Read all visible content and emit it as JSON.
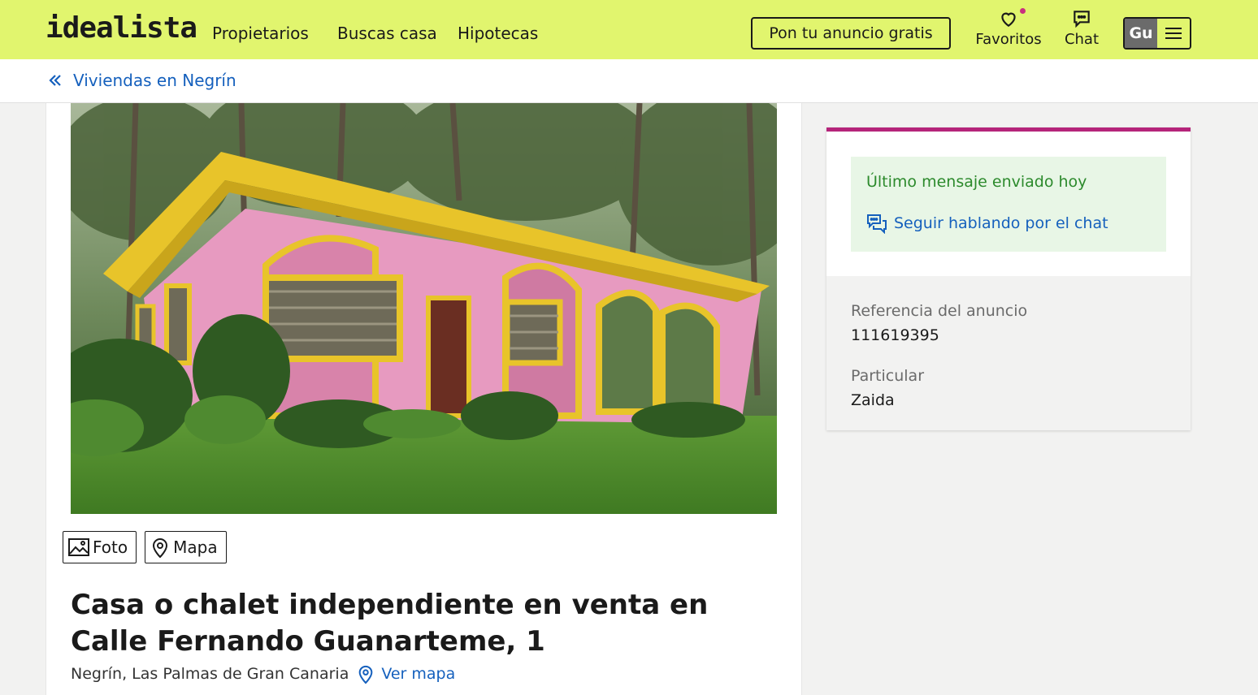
{
  "header": {
    "logo": "idealista",
    "nav": [
      "Propietarios",
      "Buscas casa",
      "Hipotecas"
    ],
    "cta_label": "Pon tu anuncio gratis",
    "favorites_label": "Favoritos",
    "chat_label": "Chat",
    "user_initials": "Gu",
    "brand_color": "#e1f56e"
  },
  "breadcrumb": {
    "label": "Viviendas en Negrín"
  },
  "listing": {
    "photo_button": "Foto",
    "map_button": "Mapa",
    "title": "Casa o chalet independiente en venta en Calle Fernando Guanarteme, 1",
    "location": "Negrín, Las Palmas de Gran Canaria",
    "map_link": "Ver mapa"
  },
  "contact_card": {
    "accent_color": "#b5247a",
    "status": "Último mensaje enviado hoy",
    "chat_link": "Seguir hablando por el chat",
    "reference_label": "Referencia del anuncio",
    "reference_value": "111619395",
    "advertiser_type": "Particular",
    "advertiser_name": "Zaida"
  }
}
